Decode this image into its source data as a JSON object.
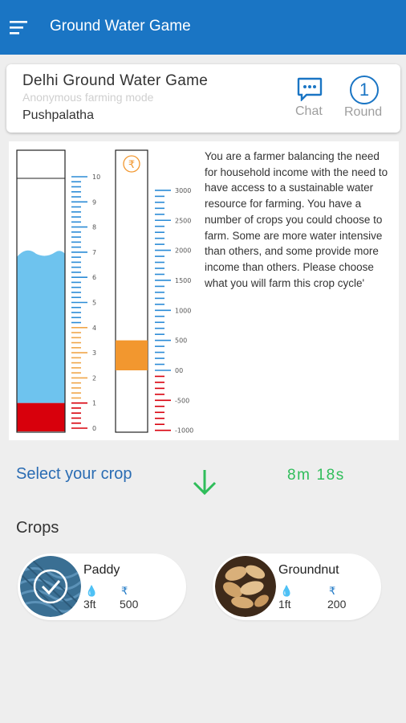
{
  "appbar": {
    "title": "Ground Water Game"
  },
  "game_info": {
    "title": "Delhi Ground Water Game",
    "mode": "Anonymous farming mode",
    "player": "Pushpalatha",
    "chat_label": "Chat",
    "round_label": "Round",
    "round_number": "1"
  },
  "water_gauge": {
    "ticks": [
      "10",
      "9",
      "8",
      "7",
      "6",
      "5",
      "4",
      "3",
      "2",
      "1",
      "0"
    ],
    "water_level": 7.0,
    "red_level": 1.0,
    "colors": {
      "water": "#6ec3ee",
      "danger": "#d8000c",
      "ticks_high": "#2b8bd6",
      "ticks_mid": "#f0a64a",
      "ticks_low": "#d8000c"
    }
  },
  "money_gauge": {
    "currency_symbol": "₹",
    "ticks": [
      "3000",
      "2500",
      "2000",
      "1500",
      "1000",
      "500",
      "00",
      "-500",
      "-1000"
    ],
    "value": 500,
    "colors": {
      "fill": "#f2972f",
      "ticks_pos": "#2b8bd6",
      "ticks_neg": "#d8000c"
    }
  },
  "intro": "You are a farmer balancing the need for household income with the need to have access to a sustainable water resource for farming. You have a number of crops you could choose to farm. Some are more water intensive than others, and some provide more income than others. Please choose what you will farm this crop cycle'",
  "selection": {
    "heading": "Select your crop",
    "timer": "8m 18s"
  },
  "crops": {
    "heading": "Crops",
    "items": [
      {
        "name": "Paddy",
        "water": "3ft",
        "income": "500",
        "water_icon": "💧",
        "income_icon": "₹",
        "selected": true
      },
      {
        "name": "Groundnut",
        "water": "1ft",
        "income": "200",
        "water_icon": "💧",
        "income_icon": "₹",
        "selected": false
      }
    ]
  },
  "colors": {
    "primary": "#1a75c4",
    "accent_green": "#2fbd5a"
  }
}
